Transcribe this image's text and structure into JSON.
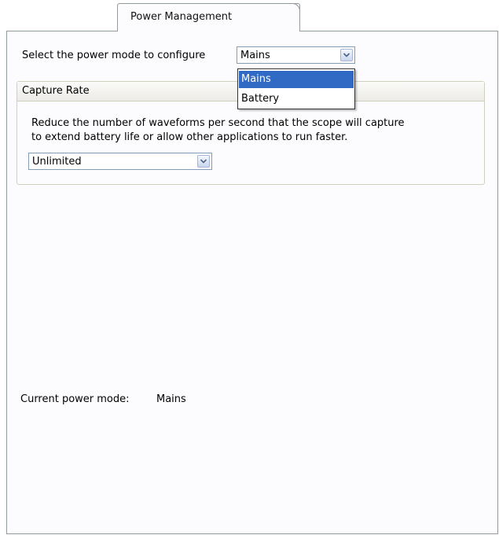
{
  "tab": {
    "label": "Power Management"
  },
  "mode_select": {
    "label": "Select the power mode to configure",
    "value": "Mains",
    "options": [
      "Mains",
      "Battery"
    ],
    "highlighted": "Mains"
  },
  "capture_rate": {
    "title": "Capture Rate",
    "description_line1": "Reduce the number of waveforms per second that the scope will capture",
    "description_line2": "to extend battery life or allow other applications to run faster.",
    "value": "Unlimited"
  },
  "status": {
    "label": "Current power mode:",
    "value": "Mains"
  },
  "colors": {
    "selection": "#316ac5",
    "border": "#919b9c",
    "combo_border": "#7f9db9"
  }
}
